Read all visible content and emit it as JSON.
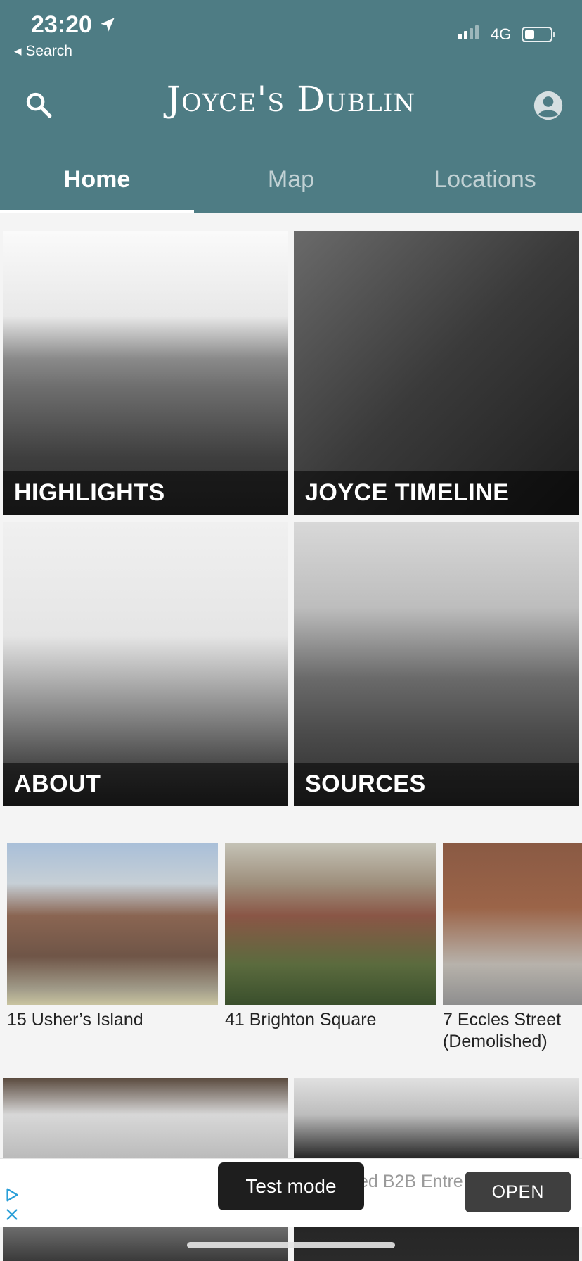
{
  "status_bar": {
    "time": "23:20",
    "back_label": "◂ Search",
    "network": "4G"
  },
  "header": {
    "title": "Joyce's Dublin"
  },
  "tabs": [
    {
      "label": "Home",
      "active": true
    },
    {
      "label": "Map",
      "active": false
    },
    {
      "label": "Locations",
      "active": false
    }
  ],
  "tiles": [
    {
      "label": "HIGHLIGHTS"
    },
    {
      "label": "JOYCE TIMELINE"
    },
    {
      "label": "ABOUT"
    },
    {
      "label": "SOURCES"
    }
  ],
  "locations": [
    {
      "name": "15 Usher’s Island"
    },
    {
      "name": "41 Brighton Square"
    },
    {
      "name": "7 Eccles Street (Demolished)"
    }
  ],
  "ad": {
    "text": "ed B2B Entre 250'000 De",
    "open_label": "OPEN",
    "test_mode_label": "Test mode"
  },
  "colors": {
    "header_bg": "#4e7c84",
    "page_bg": "#f4f4f4"
  }
}
